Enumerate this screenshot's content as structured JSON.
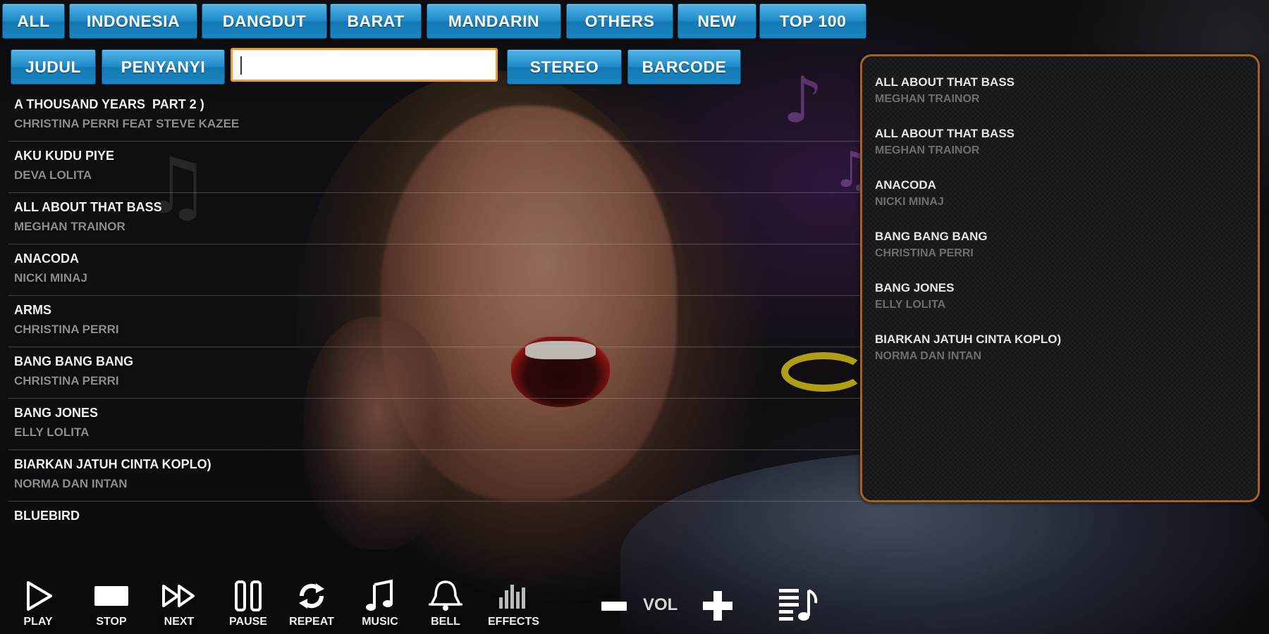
{
  "categories": [
    {
      "label": "ALL"
    },
    {
      "label": "INDONESIA"
    },
    {
      "label": "DANGDUT"
    },
    {
      "label": "BARAT"
    },
    {
      "label": "MANDARIN"
    },
    {
      "label": "OTHERS"
    },
    {
      "label": "NEW"
    },
    {
      "label": "TOP 100"
    }
  ],
  "search": {
    "by_title_label": "JUDUL",
    "by_singer_label": "PENYANYI",
    "value": "",
    "stereo_label": "STEREO",
    "barcode_label": "BARCODE"
  },
  "songs": [
    {
      "title": "A THOUSAND YEARS  PART 2 )",
      "artist": "CHRISTINA PERRI FEAT STEVE KAZEE"
    },
    {
      "title": "AKU KUDU PIYE",
      "artist": "DEVA LOLITA"
    },
    {
      "title": "ALL ABOUT THAT BASS",
      "artist": "MEGHAN TRAINOR"
    },
    {
      "title": "ANACODA",
      "artist": "NICKI MINAJ"
    },
    {
      "title": "ARMS",
      "artist": "CHRISTINA PERRI"
    },
    {
      "title": "BANG BANG BANG",
      "artist": "CHRISTINA PERRI"
    },
    {
      "title": "BANG JONES",
      "artist": "ELLY LOLITA"
    },
    {
      "title": "BIARKAN JATUH CINTA KOPLO)",
      "artist": "NORMA DAN INTAN"
    },
    {
      "title": "BLUEBIRD",
      "artist": ""
    }
  ],
  "queue": [
    {
      "title": "ALL ABOUT THAT BASS",
      "artist": "MEGHAN TRAINOR"
    },
    {
      "title": "ALL ABOUT THAT BASS",
      "artist": "MEGHAN TRAINOR"
    },
    {
      "title": "ANACODA",
      "artist": "NICKI MINAJ"
    },
    {
      "title": "BANG BANG BANG",
      "artist": "CHRISTINA PERRI"
    },
    {
      "title": "BANG JONES",
      "artist": "ELLY LOLITA"
    },
    {
      "title": "BIARKAN JATUH CINTA KOPLO)",
      "artist": "NORMA DAN INTAN"
    }
  ],
  "controls": {
    "play": "PLAY",
    "stop": "STOP",
    "next": "NEXT",
    "pause": "PAUSE",
    "repeat": "REPEAT",
    "music": "MUSIC",
    "bell": "BELL",
    "effects": "EFFECTS",
    "volume": "VOL"
  },
  "icons": {
    "play": "play-icon",
    "stop": "stop-icon",
    "next": "next-icon",
    "pause": "pause-icon",
    "repeat": "repeat-icon",
    "music": "music-note-icon",
    "bell": "bell-icon",
    "effects": "equalizer-icon",
    "vol_down": "minus-icon",
    "vol_up": "plus-icon",
    "playlist": "playlist-icon"
  },
  "colors": {
    "button_blue": "#1f8cc9",
    "search_border": "#f29a2e",
    "queue_border": "#a8621c",
    "artist_gray": "#8d8d8d"
  }
}
